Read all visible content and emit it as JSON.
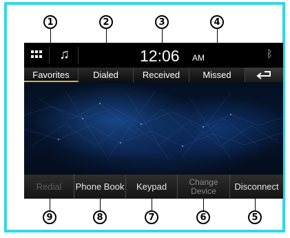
{
  "callouts": {
    "c1": "1",
    "c2": "2",
    "c3": "3",
    "c4": "4",
    "c5": "5",
    "c6": "6",
    "c7": "7",
    "c8": "8",
    "c9": "9"
  },
  "status_bar": {
    "menu_icon": "grid-menu-icon",
    "music_icon": "music-note-icon",
    "time": "12:06",
    "ampm": "AM",
    "bluetooth_icon": "bluetooth-icon"
  },
  "tabs": [
    {
      "label": "Favorites",
      "active": true
    },
    {
      "label": "Dialed"
    },
    {
      "label": "Received"
    },
    {
      "label": "Missed"
    }
  ],
  "back_icon": "back-arrow-icon",
  "buttons": {
    "redial": "Redial",
    "phone_book": "Phone Book",
    "keypad": "Keypad",
    "change_device_line1": "Change",
    "change_device_line2": "Device",
    "disconnect": "Disconnect"
  },
  "colors": {
    "frame_border": "#2fd8ea",
    "active_tab_underline": "#e0b040",
    "screen_bg": "#051022"
  }
}
